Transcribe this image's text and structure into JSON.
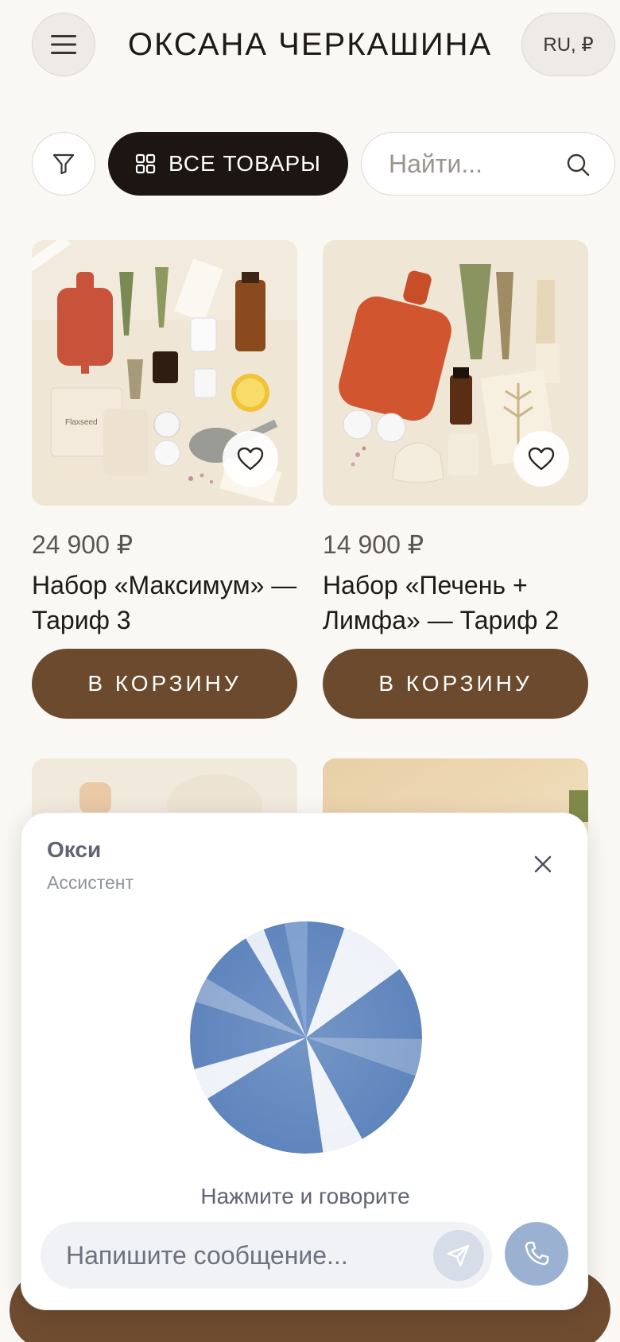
{
  "header": {
    "brand": "ОКСАНА ЧЕРКАШИНА",
    "locale": "RU, ₽",
    "menu_icon": "hamburger-icon"
  },
  "toolbar": {
    "filter_icon": "filter-icon",
    "all_products_label": "ВСЕ ТОВАРЫ",
    "search_placeholder": "Найти..."
  },
  "products": [
    {
      "price": "24 900 ₽",
      "name": "Набор «Максимум» — Тариф 3",
      "cart_label": "В КОРЗИНУ"
    },
    {
      "price": "14 900 ₽",
      "name": "Набор «Печень + Лимфа» — Тариф 2",
      "cart_label": "В КОРЗИНУ"
    }
  ],
  "assistant": {
    "name": "Окси",
    "role": "Ассистент",
    "hint": "Нажмите и говорите",
    "message_placeholder": "Напишите сообщение...",
    "orb_color": "#6f92c4"
  },
  "colors": {
    "background": "#faf8f4",
    "accent_dark": "#1c1512",
    "cart_button": "#6c4a2d",
    "call_button": "#9ab1d1"
  }
}
